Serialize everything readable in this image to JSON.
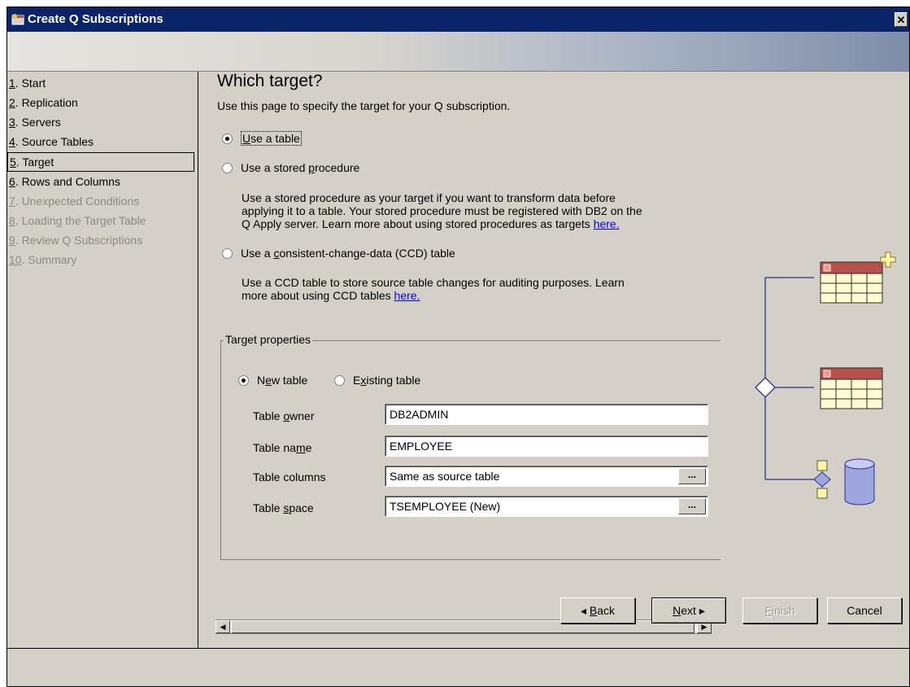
{
  "window": {
    "title": "Create Q Subscriptions",
    "close_glyph": "✕"
  },
  "nav": {
    "items": [
      {
        "num": "1",
        "label": ". Start",
        "state": "normal"
      },
      {
        "num": "2",
        "label": ". Replication",
        "state": "normal"
      },
      {
        "num": "3",
        "label": ". Servers",
        "state": "normal"
      },
      {
        "num": "4",
        "label": ". Source Tables",
        "state": "normal"
      },
      {
        "num": "5",
        "label": ". Target",
        "state": "selected"
      },
      {
        "num": "6",
        "label": ". Rows and Columns",
        "state": "normal"
      },
      {
        "num": "7",
        "label": ". Unexpected Conditions",
        "state": "disabled"
      },
      {
        "num": "8",
        "label": ". Loading the Target Table",
        "state": "disabled"
      },
      {
        "num": "9",
        "label": ". Review Q Subscriptions",
        "state": "disabled"
      },
      {
        "num": "10",
        "label": ". Summary",
        "state": "disabled"
      }
    ]
  },
  "page": {
    "heading": "Which target?",
    "subheading": "Use this page to specify the target for your Q subscription.",
    "options": {
      "table": {
        "label_pre": "",
        "label_ul": "U",
        "label_post": "se a table",
        "checked": true
      },
      "stored_procedure": {
        "label_pre": "Use a stored ",
        "label_ul": "p",
        "label_post": "rocedure",
        "checked": false,
        "desc_line1": "Use a stored procedure as your target if you want to transform data before",
        "desc_line2": "applying it to a table. Your stored procedure must be registered with DB2 on the",
        "desc_line3": "Q Apply server. Learn more about using stored procedures as targets ",
        "link": "here."
      },
      "ccd": {
        "label_pre": "Use a ",
        "label_ul": "c",
        "label_post": "onsistent-change-data (CCD) table",
        "checked": false,
        "desc_line1": "Use a CCD table to store source table changes for auditing purposes. Learn",
        "desc_line2": "more about using CCD tables ",
        "link": "here."
      }
    },
    "target_properties": {
      "legend": "Target properties",
      "new_table": {
        "label_pre": "N",
        "label_ul": "e",
        "label_post": "w table",
        "checked": true
      },
      "existing_table": {
        "label_pre": "E",
        "label_ul": "x",
        "label_post": "isting table",
        "checked": false
      },
      "fields": {
        "owner": {
          "label_pre": "Table ",
          "label_ul": "o",
          "label_post": "wner",
          "value": "DB2ADMIN"
        },
        "name": {
          "label_pre": "Table na",
          "label_ul": "m",
          "label_post": "e",
          "value": "EMPLOYEE"
        },
        "columns": {
          "label": "Table columns",
          "value": "Same as source table",
          "button": "..."
        },
        "space": {
          "label_pre": "Table ",
          "label_ul": "s",
          "label_post": "pace",
          "value": "TSEMPLOYEE (New)",
          "button": "..."
        }
      }
    }
  },
  "buttons": {
    "back": {
      "arrow": "◂ ",
      "ul": "B",
      "rest": "ack"
    },
    "next": {
      "ul": "N",
      "rest": "ext",
      "arrow": " ▸"
    },
    "finish": {
      "ul": "F",
      "rest": "inish"
    },
    "cancel": "Cancel"
  },
  "colors": {
    "titlebar": "#0a246a",
    "dialog_face": "#d4d0c8",
    "table_icon_header": "#b5514a",
    "table_icon_body": "#fffbd0",
    "cylinder": "#9ea6e0",
    "diagram_line": "#2f2f8f"
  }
}
